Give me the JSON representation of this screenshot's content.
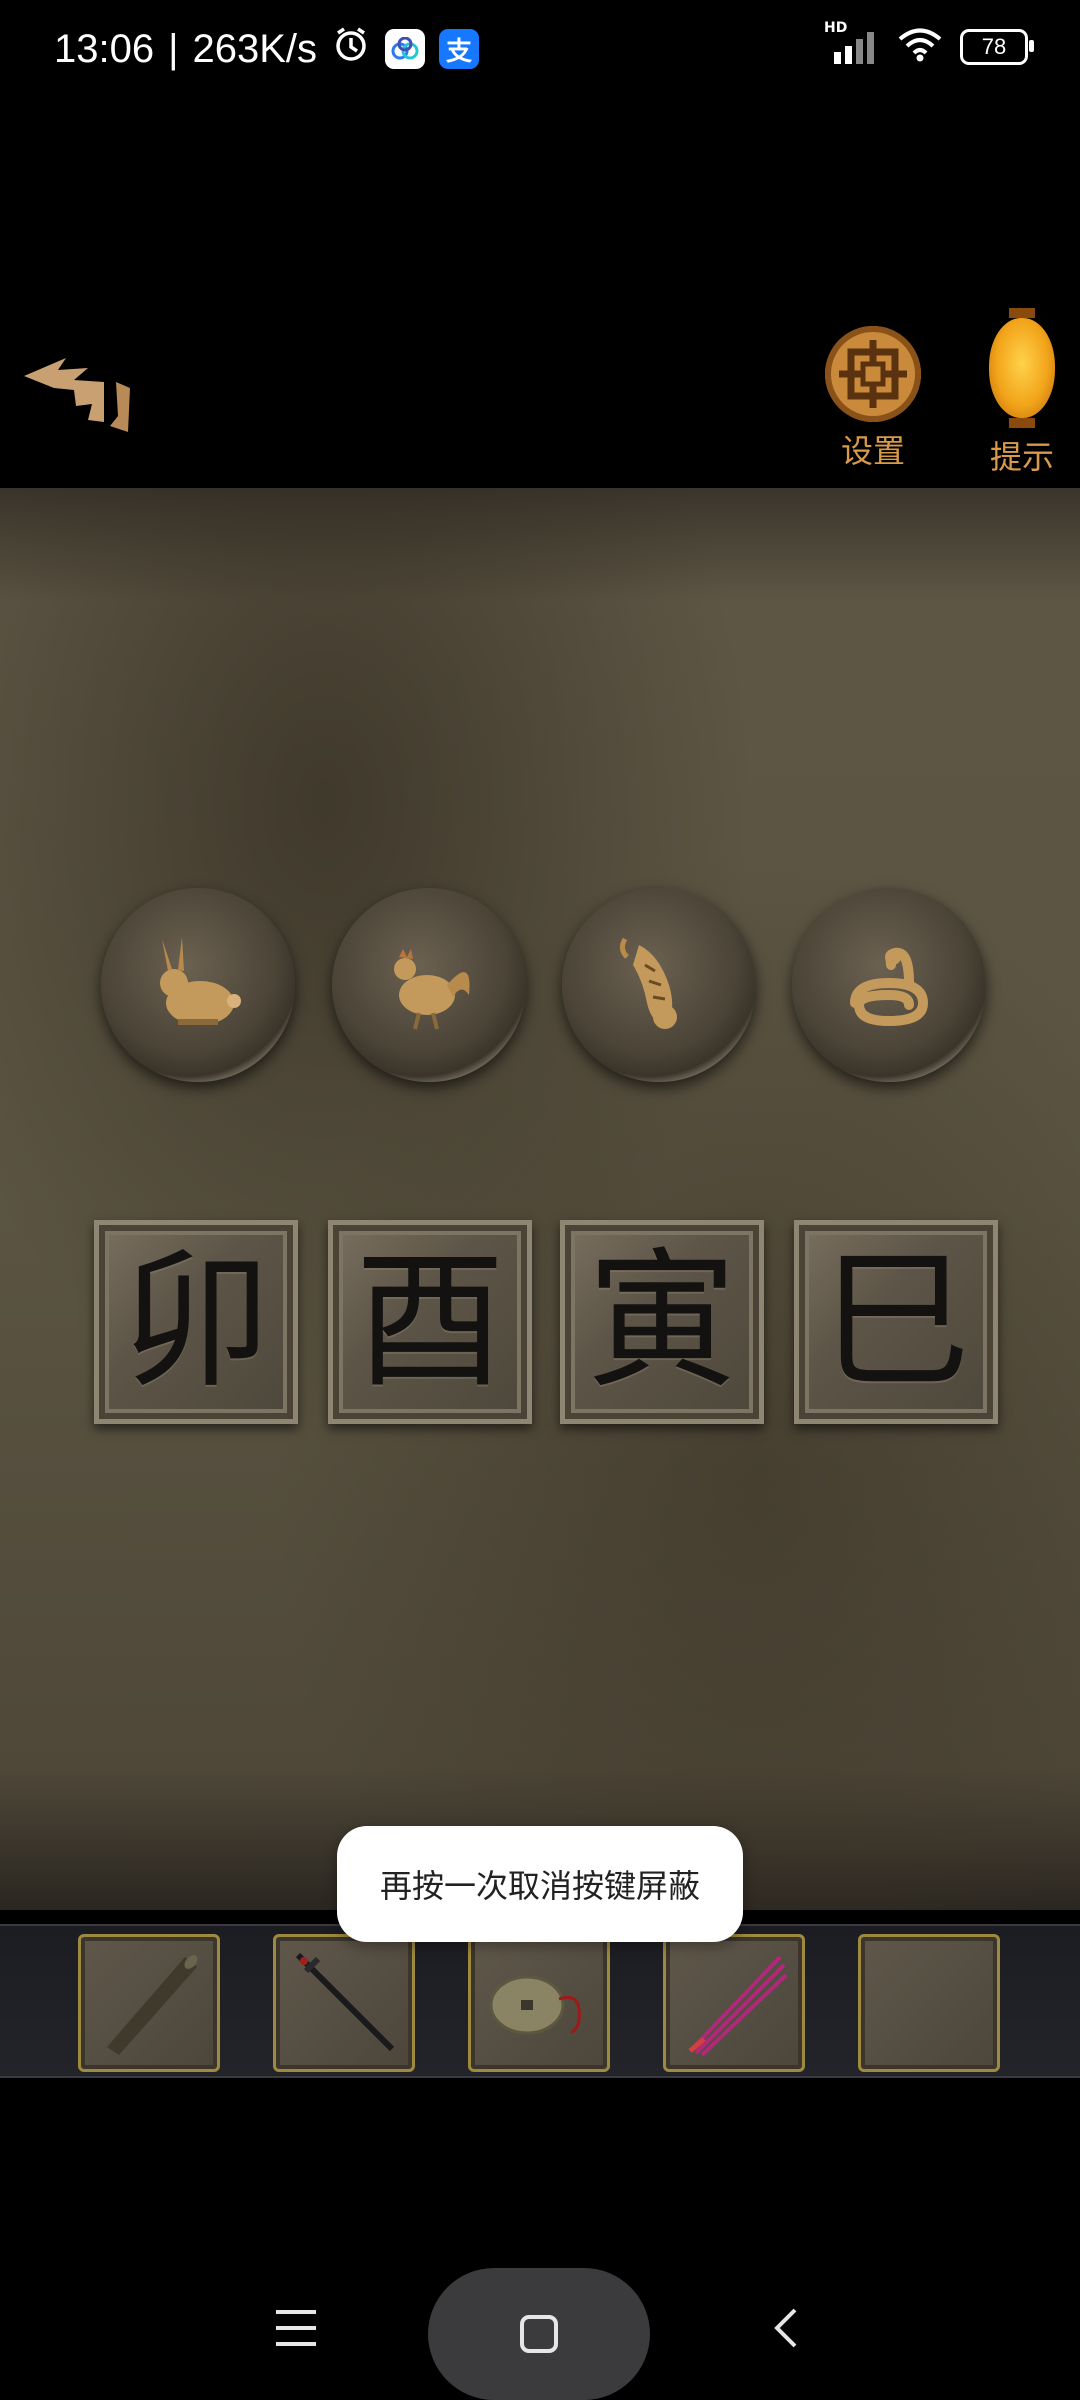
{
  "status_bar": {
    "time": "13:06",
    "separator": "|",
    "net_speed": "263K/s",
    "alarm_icon": "alarm-icon",
    "apps": [
      "baidu-netdisk-icon",
      "alipay-icon"
    ],
    "alipay_glyph": "支",
    "signal_label": "HD",
    "battery": "78"
  },
  "top_bar": {
    "back_icon": "back-arrow-icon",
    "settings_label": "设置",
    "hint_label": "提示"
  },
  "puzzle": {
    "medallions": [
      {
        "name": "rabbit-medallion",
        "animal": "rabbit"
      },
      {
        "name": "rooster-medallion",
        "animal": "rooster"
      },
      {
        "name": "tiger-medallion",
        "animal": "tiger"
      },
      {
        "name": "snake-medallion",
        "animal": "snake"
      }
    ],
    "tiles": [
      {
        "name": "tile-mao",
        "glyph": "卯"
      },
      {
        "name": "tile-you",
        "glyph": "酉"
      },
      {
        "name": "tile-yin",
        "glyph": "寅"
      },
      {
        "name": "tile-si",
        "glyph": "巳"
      }
    ]
  },
  "toast": {
    "text": "再按一次取消按键屏蔽"
  },
  "inventory": {
    "slots": [
      {
        "name": "scroll-tube-item",
        "item": "scroll-tube"
      },
      {
        "name": "sword-item",
        "item": "sword"
      },
      {
        "name": "coin-item",
        "item": "coin"
      },
      {
        "name": "incense-item",
        "item": "incense"
      },
      {
        "name": "empty-slot",
        "item": ""
      }
    ]
  },
  "nav_bar": {
    "menu_icon": "menu-icon",
    "home_icon": "home-icon",
    "back_icon": "back-icon"
  },
  "colors": {
    "accent_gold": "#d99a4a",
    "slot_border": "#9e8a3e",
    "panel_bg": "#5b5442"
  }
}
